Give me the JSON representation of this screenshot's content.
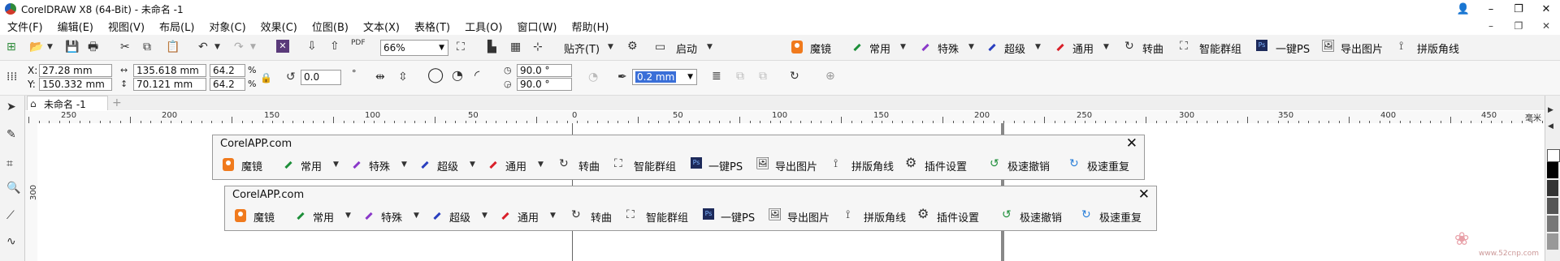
{
  "window": {
    "title": "CorelDRAW X8 (64-Bit) - 未命名 -1",
    "buttons": [
      "👤",
      "–",
      "❐",
      "✕"
    ]
  },
  "menubar": {
    "items": [
      "文件(F)",
      "编辑(E)",
      "视图(V)",
      "布局(L)",
      "对象(C)",
      "效果(C)",
      "位图(B)",
      "文本(X)",
      "表格(T)",
      "工具(O)",
      "窗口(W)",
      "帮助(H)"
    ],
    "window_controls": [
      "–",
      "❐",
      "✕"
    ]
  },
  "standard_toolbar": {
    "zoom": "66%",
    "snap_label": "贴齐(T)",
    "launch_label": "启动",
    "pdf_label": "PDF",
    "plugins": {
      "magic": "魔镜",
      "common": "常用",
      "special": "特殊",
      "super": "超级",
      "general": "通用",
      "convert_curve": "转曲",
      "smart_group": "智能群组",
      "one_key_ps": "一键PS",
      "export_image": "导出图片",
      "imposition_marks": "拼版角线"
    }
  },
  "property_bar": {
    "x_label": "X:",
    "y_label": "Y:",
    "x_value": "27.28 mm",
    "y_value": "150.332 mm",
    "width": "135.618 mm",
    "height": "70.121 mm",
    "scale_x": "64.2",
    "scale_y": "64.2",
    "percent": "%",
    "rotation": "0.0",
    "degree_mark": "°",
    "angle_start": "90.0 °",
    "angle_end": "90.0 °",
    "outline_width": "0.2 mm"
  },
  "document": {
    "tab_label": "未命名 -1",
    "add_tab": "+",
    "ruler_labels": [
      "250",
      "200",
      "150",
      "100",
      "50",
      "0",
      "50",
      "100",
      "150",
      "200",
      "250",
      "300",
      "350",
      "400",
      "450"
    ],
    "ruler_unit": "毫米",
    "vruler_label": "300"
  },
  "floating_toolbar_1": {
    "title": "CorelAPP.com",
    "close": "✕",
    "items": [
      "魔镜",
      "常用",
      "特殊",
      "超级",
      "通用",
      "转曲",
      "智能群组",
      "一键PS",
      "导出图片",
      "拼版角线",
      "插件设置",
      "极速撤销",
      "极速重复"
    ]
  },
  "floating_toolbar_2": {
    "title": "CorelAPP.com",
    "close": "✕",
    "items": [
      "魔镜",
      "常用",
      "特殊",
      "超级",
      "通用",
      "转曲",
      "智能群组",
      "一键PS",
      "导出图片",
      "拼版角线",
      "插件设置",
      "极速撤销",
      "极速重复"
    ]
  },
  "watermark": {
    "site": "www.52cnp.com"
  },
  "colors": {
    "accent_orange": "#f07a1d",
    "green": "#1e8f3a",
    "purple": "#8a39c9",
    "blue": "#2a3fbf",
    "red": "#d9202a",
    "selection": "#3a6fd8"
  }
}
